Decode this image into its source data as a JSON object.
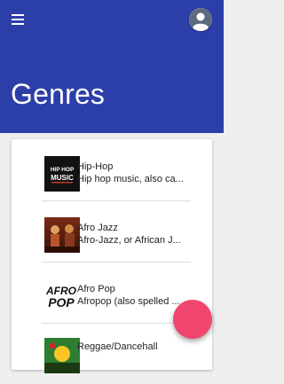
{
  "header": {
    "title": "Genres",
    "menu_icon": "hamburger-menu-icon",
    "avatar_icon": "account-avatar-icon",
    "color": "#2c3ea8"
  },
  "genres": [
    {
      "name": "Hip-Hop",
      "description": "Hip hop music, also ca...",
      "thumb_text": "HIP HOP MUSIC"
    },
    {
      "name": "Afro Jazz",
      "description": "Afro-Jazz, or African J...",
      "thumb_text": ""
    },
    {
      "name": "Afro Pop",
      "description": "Afropop (also spelled ...",
      "thumb_text": "AFRO POP"
    },
    {
      "name": "Reggae/Dancehall",
      "description": "",
      "thumb_text": ""
    }
  ],
  "fab": {
    "icon": "add-fab",
    "color": "#f0466e"
  }
}
